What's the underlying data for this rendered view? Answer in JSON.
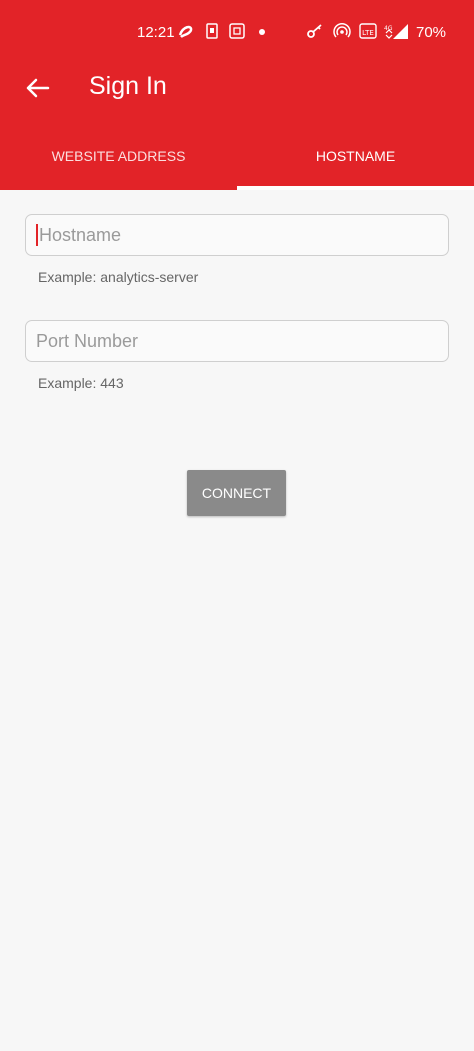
{
  "status_bar": {
    "time": "12:21",
    "battery": "70%",
    "icons": [
      "airtel-icon",
      "sim-icon",
      "screenshot-icon",
      "notification-dot",
      "key-icon",
      "hotspot-icon",
      "volte-icon",
      "4g-signal-icon"
    ]
  },
  "toolbar": {
    "title": "Sign In",
    "back_icon": "arrow-back-icon"
  },
  "tabs": [
    {
      "label": "WEBSITE ADDRESS",
      "active": false
    },
    {
      "label": "HOSTNAME",
      "active": true
    }
  ],
  "form": {
    "hostname": {
      "placeholder": "Hostname",
      "value": "",
      "hint": "Example: analytics-server"
    },
    "port": {
      "placeholder": "Port Number",
      "value": "",
      "hint": "Example: 443"
    },
    "connect_label": "CONNECT"
  },
  "colors": {
    "primary": "#e22328",
    "button_disabled": "#8a8a8a",
    "background": "#f7f7f7"
  }
}
